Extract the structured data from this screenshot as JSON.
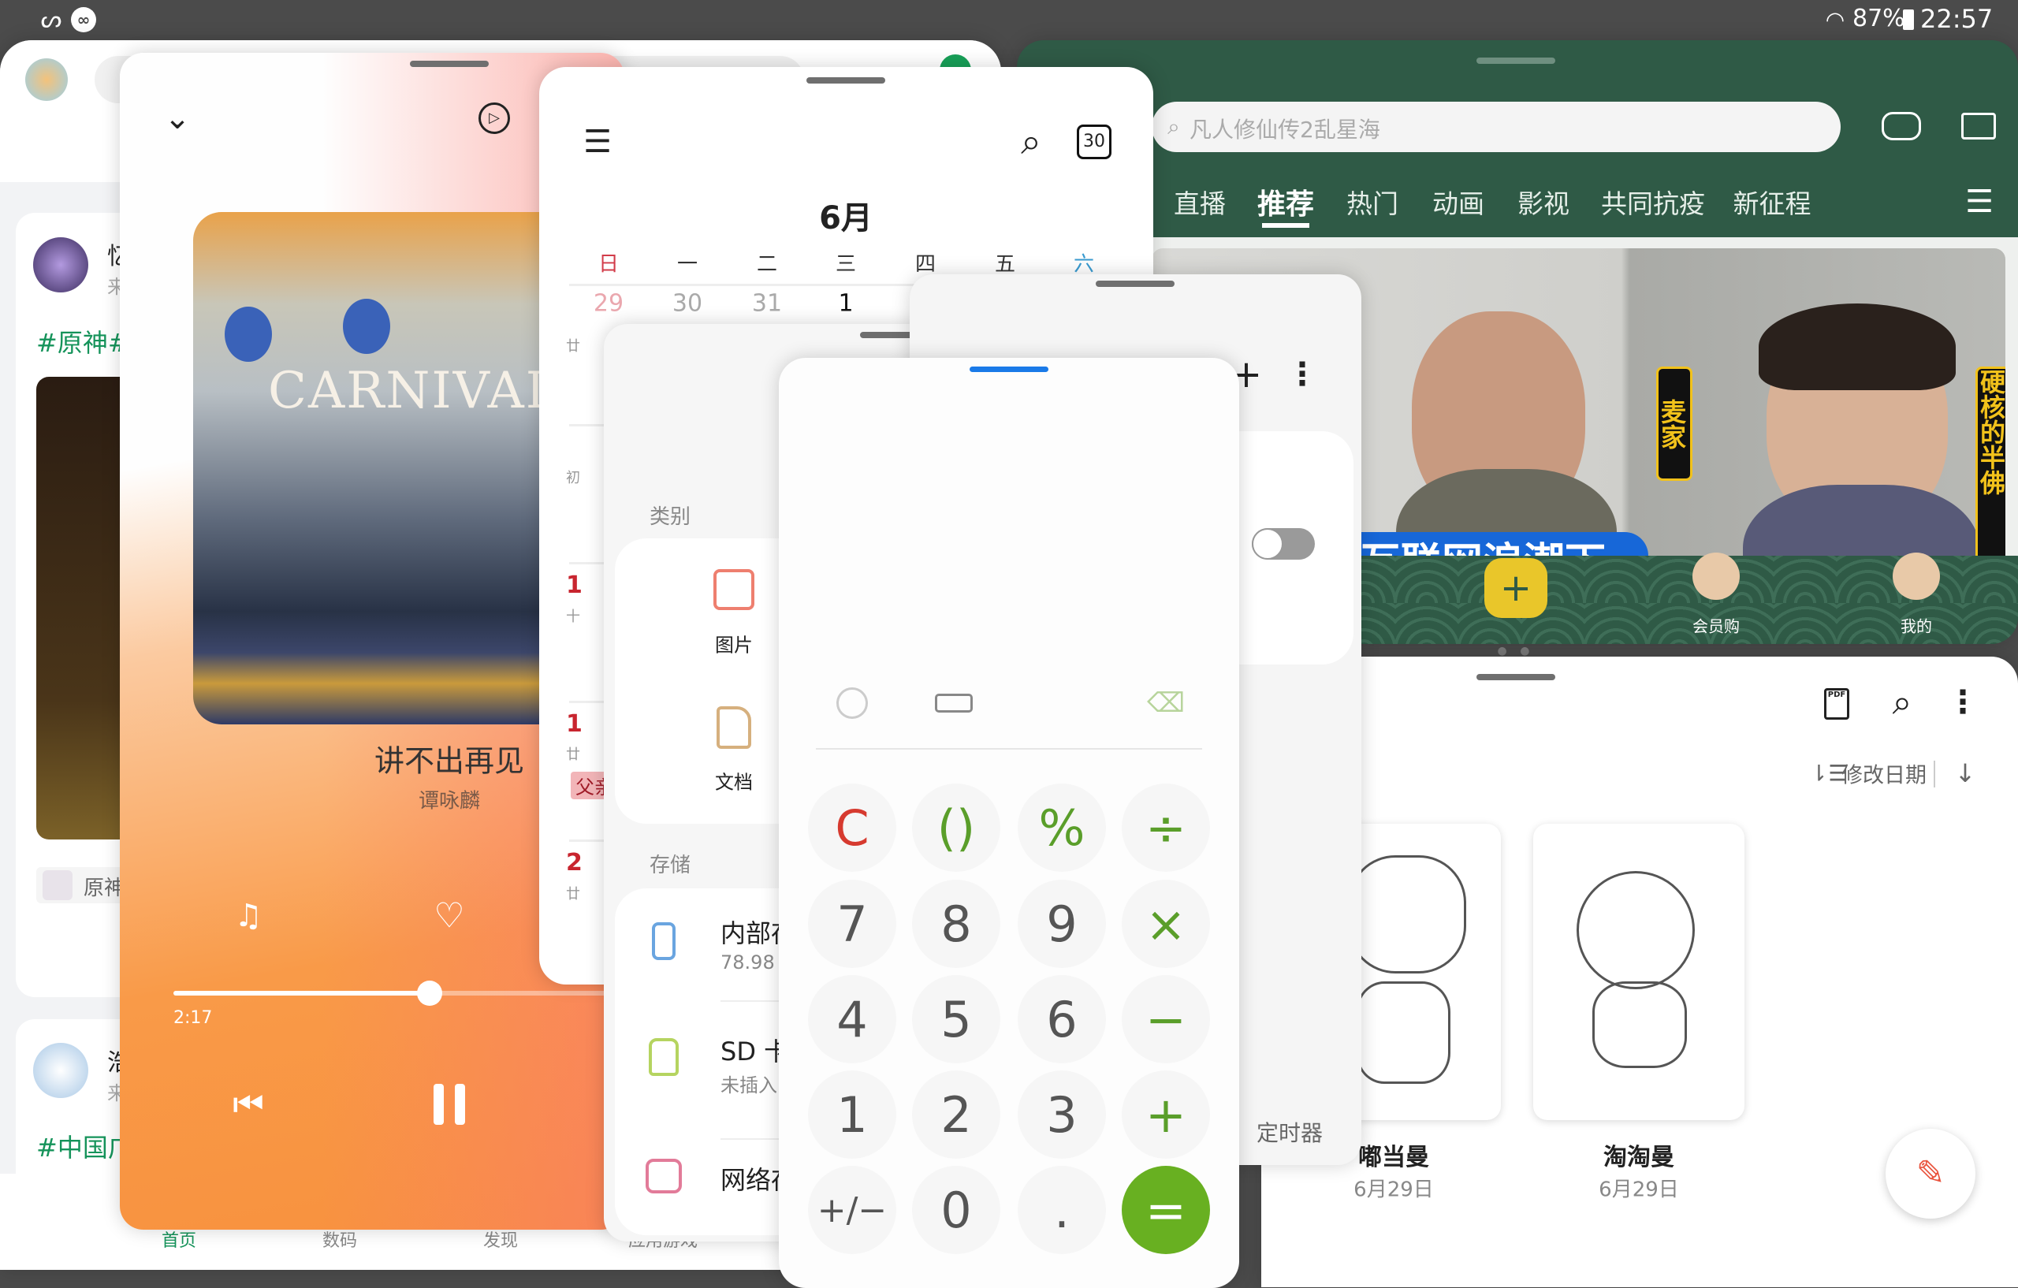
{
  "status_bar": {
    "battery": "87%",
    "time": "22:57",
    "left_icons": [
      "link-app-icon",
      "infinity-app-icon"
    ],
    "right_icons": [
      "wifi-icon",
      "battery-icon"
    ]
  },
  "community": {
    "posts": [
      {
        "author": "忆",
        "subtitle": "来",
        "topic": "#原神#",
        "game_tag": "原神"
      },
      {
        "author": "浩",
        "subtitle": "来",
        "topic": "#中国广"
      }
    ],
    "bottom_nav": [
      {
        "label": "首页",
        "active": true
      },
      {
        "label": "数码"
      },
      {
        "label": "发现"
      },
      {
        "label": "应用游戏"
      }
    ],
    "accent": "#15935a"
  },
  "bilibili": {
    "search_placeholder": "凡人修仙传2乱星海",
    "tabs": [
      {
        "label": "直播"
      },
      {
        "label": "推荐",
        "active": true
      },
      {
        "label": "热门"
      },
      {
        "label": "动画"
      },
      {
        "label": "影视"
      },
      {
        "label": "共同抗疫"
      },
      {
        "label": "新征程"
      }
    ],
    "banner": {
      "caption": "互联网浪潮下",
      "name_left": "麦家",
      "name_right": "硬核的半佛"
    },
    "bottom_nav": [
      {
        "label": "会员购"
      },
      {
        "label": "我的"
      }
    ],
    "theme_color": "#2f5a46",
    "plus_color": "#e9c62a"
  },
  "notes": {
    "sort_label": "修改日期",
    "items": [
      {
        "title": "嘟当曼",
        "date": "6月29日"
      },
      {
        "title": "淘淘曼",
        "date": "6月29日"
      }
    ],
    "fab_color": "#e9553f"
  },
  "music": {
    "album_text": "CARNIVAL",
    "song_title": "讲不出再见",
    "artist": "谭咏麟",
    "elapsed": "2:17",
    "progress": 0.5,
    "favorited": false,
    "playing": true
  },
  "calendar": {
    "month": "6月",
    "today_badge": "30",
    "weekdays": [
      "日",
      "一",
      "二",
      "三",
      "四",
      "五",
      "六"
    ],
    "first_row": [
      "29",
      "30",
      "31",
      "1"
    ],
    "left_column": [
      {
        "day": "廿"
      },
      {
        "day": "初"
      },
      {
        "num": "1",
        "sub": "十"
      },
      {
        "num": "1",
        "sub": "廿",
        "event": "父亲"
      },
      {
        "num": "2",
        "sub": "廿"
      }
    ]
  },
  "files": {
    "categories_label": "类别",
    "categories": [
      {
        "label": "图片",
        "icon": "image-icon",
        "color": "#ee7f6f"
      },
      {
        "label": "文档",
        "icon": "document-icon",
        "color": "#d6b07e"
      }
    ],
    "storage_label": "存储",
    "storage": [
      {
        "name": "内部存储",
        "detail": "78.98",
        "icon": "phone-icon",
        "color": "#6aa5e0"
      },
      {
        "name": "SD 卡",
        "detail": "未插入",
        "icon": "sd-card-icon",
        "color": "#b5d460"
      },
      {
        "name": "网络存储",
        "icon": "network-storage-icon",
        "color": "#e27b99"
      }
    ]
  },
  "settings": {
    "toggle_on": false,
    "timer_label": "定时器"
  },
  "calculator": {
    "keys": [
      {
        "label": "C",
        "kind": "clear"
      },
      {
        "label": "()",
        "kind": "op"
      },
      {
        "label": "%",
        "kind": "op"
      },
      {
        "label": "÷",
        "kind": "op"
      },
      {
        "label": "7"
      },
      {
        "label": "8"
      },
      {
        "label": "9"
      },
      {
        "label": "×",
        "kind": "op"
      },
      {
        "label": "4"
      },
      {
        "label": "5"
      },
      {
        "label": "6"
      },
      {
        "label": "−",
        "kind": "op"
      },
      {
        "label": "1"
      },
      {
        "label": "2"
      },
      {
        "label": "3"
      },
      {
        "label": "+",
        "kind": "op"
      },
      {
        "label": "+/−"
      },
      {
        "label": "0"
      },
      {
        "label": "."
      },
      {
        "label": "=",
        "kind": "equals"
      }
    ],
    "colors": {
      "clear": "#d63a2f",
      "op": "#5a9e2a",
      "equals": "#68b021",
      "digit": "#555555"
    }
  }
}
